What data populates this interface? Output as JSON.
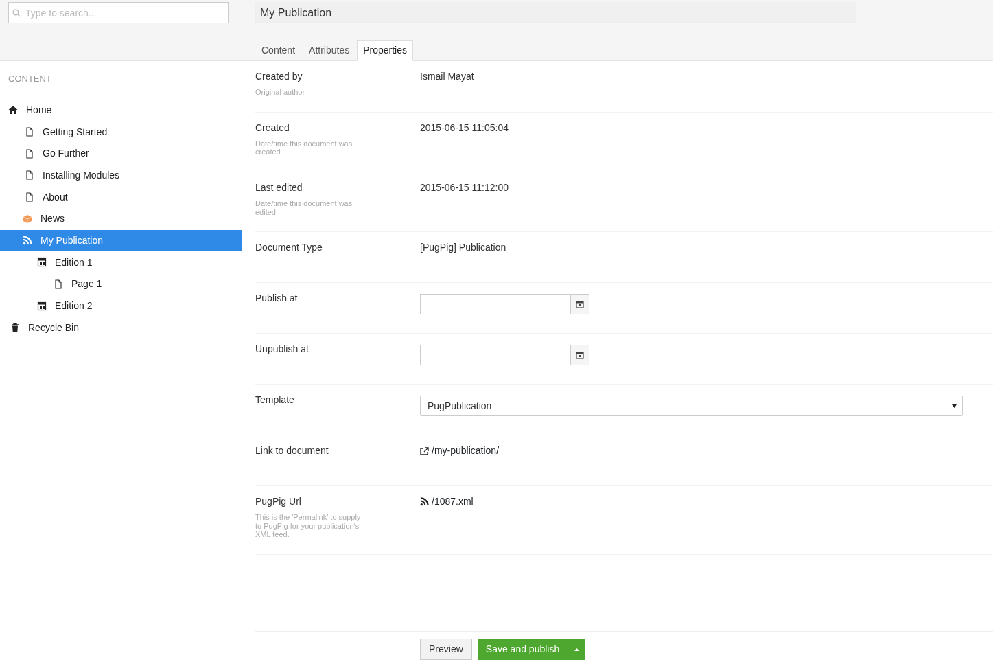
{
  "search": {
    "placeholder": "Type to search..."
  },
  "sidebar": {
    "section_title": "CONTENT",
    "tree": [
      {
        "label": "Home",
        "kind": "home",
        "selected": false,
        "children": [
          {
            "label": "Getting Started",
            "kind": "page",
            "selected": false
          },
          {
            "label": "Go Further",
            "kind": "page",
            "selected": false
          },
          {
            "label": "Installing Modules",
            "kind": "page",
            "selected": false
          },
          {
            "label": "About",
            "kind": "page",
            "selected": false
          },
          {
            "label": "News",
            "kind": "news",
            "selected": false
          },
          {
            "label": "My Publication",
            "kind": "feed",
            "selected": true,
            "children": [
              {
                "label": "Edition 1",
                "kind": "edition",
                "selected": false,
                "children": [
                  {
                    "label": "Page 1",
                    "kind": "page",
                    "selected": false
                  }
                ]
              },
              {
                "label": "Edition 2",
                "kind": "edition",
                "selected": false
              }
            ]
          }
        ]
      },
      {
        "label": "Recycle Bin",
        "kind": "bin",
        "selected": false
      }
    ]
  },
  "editor": {
    "title": "My Publication",
    "tabs": [
      {
        "label": "Content",
        "selected": false
      },
      {
        "label": "Attributes",
        "selected": false
      },
      {
        "label": "Properties",
        "selected": true
      }
    ],
    "properties": [
      {
        "kind": "text",
        "label": "Created by",
        "description": "Original author",
        "value": "Ismail Mayat"
      },
      {
        "kind": "text",
        "label": "Created",
        "description": "Date/time this document was created",
        "value": "2015-06-15 11:05:04"
      },
      {
        "kind": "text",
        "label": "Last edited",
        "description": "Date/time this document was edited",
        "value": "2015-06-15 11:12:00"
      },
      {
        "kind": "text",
        "label": "Document Type",
        "value": "[PugPig] Publication"
      },
      {
        "kind": "date",
        "label": "Publish at"
      },
      {
        "kind": "date",
        "label": "Unpublish at"
      },
      {
        "kind": "select",
        "label": "Template",
        "value": "PugPublication"
      },
      {
        "kind": "link",
        "label": "Link to document",
        "value": "/my-publication/"
      },
      {
        "kind": "feed",
        "label": "PugPig Url",
        "description": "This is the 'Permalink' to supply to PugPig for your publication's XML feed.",
        "value": "/1087.xml"
      }
    ],
    "buttons": [
      {
        "label": "Preview",
        "kind": "default"
      },
      {
        "label": "Save and publish",
        "kind": "primary"
      }
    ]
  }
}
